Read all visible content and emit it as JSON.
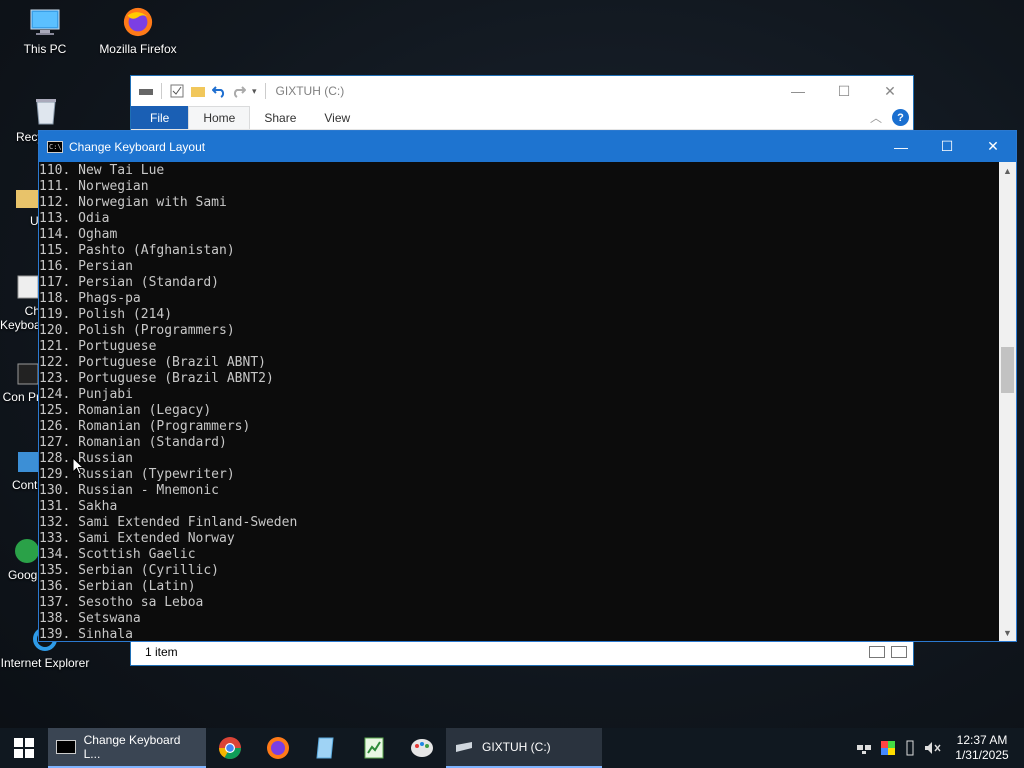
{
  "desktop": {
    "icons": [
      {
        "label": "This PC"
      },
      {
        "label": "Mozilla Firefox"
      },
      {
        "label": "Recy"
      },
      {
        "label": "Ut"
      },
      {
        "label": "Ch Keyboa"
      },
      {
        "label": "Con Pr"
      },
      {
        "label": "Conti"
      },
      {
        "label": "Googl"
      },
      {
        "label": "Internet Explorer"
      }
    ]
  },
  "explorer": {
    "title": "GIXTUH (C:)",
    "ribbon_tabs": [
      "File",
      "Home",
      "Share",
      "View"
    ],
    "help_label": "?",
    "status": "1 item"
  },
  "console": {
    "title": "Change Keyboard Layout",
    "lines": [
      "110. New Tai Lue",
      "111. Norwegian",
      "112. Norwegian with Sami",
      "113. Odia",
      "114. Ogham",
      "115. Pashto (Afghanistan)",
      "116. Persian",
      "117. Persian (Standard)",
      "118. Phags-pa",
      "119. Polish (214)",
      "120. Polish (Programmers)",
      "121. Portuguese",
      "122. Portuguese (Brazil ABNT)",
      "123. Portuguese (Brazil ABNT2)",
      "124. Punjabi",
      "125. Romanian (Legacy)",
      "126. Romanian (Programmers)",
      "127. Romanian (Standard)",
      "128. Russian",
      "129. Russian (Typewriter)",
      "130. Russian - Mnemonic",
      "131. Sakha",
      "132. Sami Extended Finland-Sweden",
      "133. Sami Extended Norway",
      "134. Scottish Gaelic",
      "135. Serbian (Cyrillic)",
      "136. Serbian (Latin)",
      "137. Sesotho sa Leboa",
      "138. Setswana",
      "139. Sinhala"
    ],
    "scroll_position": 0.42
  },
  "taskbar": {
    "tasks": [
      {
        "label": "Change Keyboard L...",
        "state": "active"
      },
      {
        "label": "GIXTUH (C:)",
        "state": "open"
      }
    ],
    "pinned": [
      "chrome-icon",
      "firefox-icon",
      "notepad-icon",
      "spreadsheet-icon",
      "paint-icon"
    ],
    "clock": {
      "time": "12:37 AM",
      "date": "1/31/2025"
    }
  },
  "colors": {
    "console_title": "#1e74d0",
    "console_bg": "#0c0c0c",
    "console_text": "#c8c8c8",
    "taskbar": "#101820"
  }
}
